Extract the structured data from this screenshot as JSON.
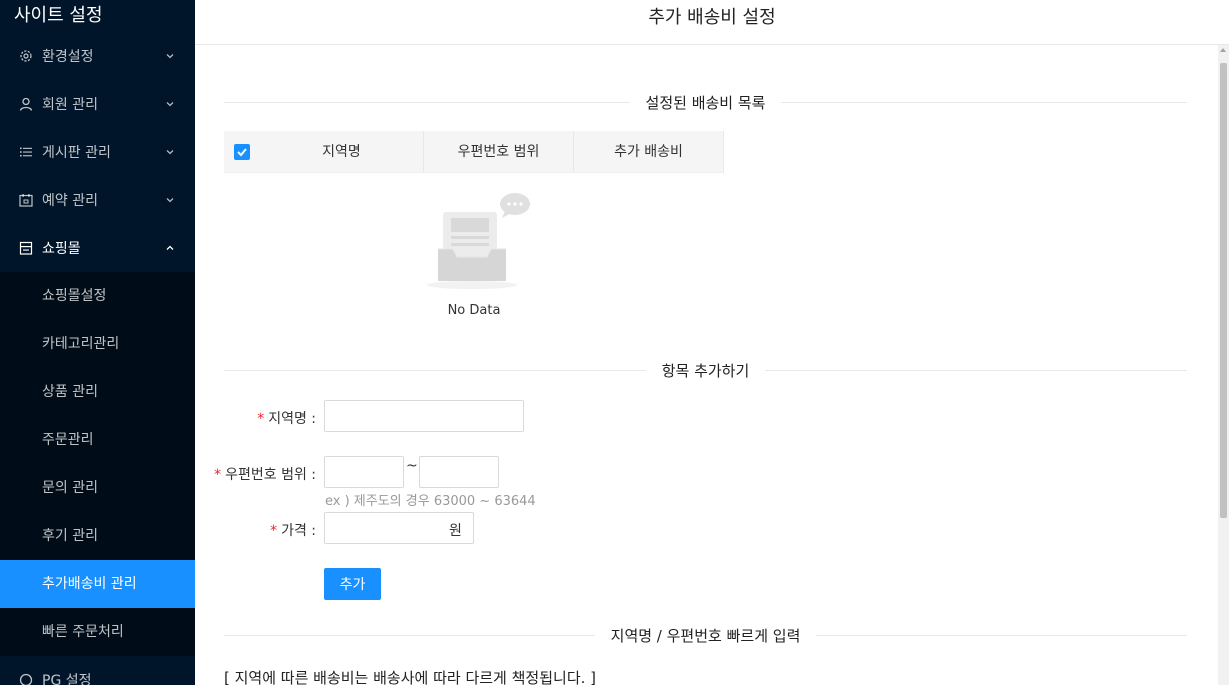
{
  "sidebar": {
    "title": "사이트 설정",
    "menu": [
      {
        "label": "환경설정"
      },
      {
        "label": "회원 관리"
      },
      {
        "label": "게시판 관리"
      },
      {
        "label": "예약 관리"
      },
      {
        "label": "쇼핑몰"
      }
    ],
    "submenu": [
      {
        "label": "쇼핑몰설정"
      },
      {
        "label": "카테고리관리"
      },
      {
        "label": "상품 관리"
      },
      {
        "label": "주문관리"
      },
      {
        "label": "문의 관리"
      },
      {
        "label": "후기 관리"
      },
      {
        "label": "추가배송비 관리"
      },
      {
        "label": "빠른 주문처리"
      }
    ],
    "bottom_item": "PG 설정"
  },
  "header": {
    "title": "추가 배송비 설정"
  },
  "list_section": {
    "divider": "설정된 배송비 목록",
    "columns": [
      "지역명",
      "우편번호 범위",
      "추가 배송비"
    ],
    "select_all_checked": true,
    "empty_text": "No Data"
  },
  "add_section": {
    "divider": "항목 추가하기",
    "region_label": "지역명 :",
    "postal_label": "우편번호 범위 :",
    "range_separator": "~",
    "postal_hint": "ex ) 제주도의 경우 63000 ~ 63644",
    "price_label": "가격 :",
    "price_suffix": "원",
    "submit_label": "추가"
  },
  "quick_section": {
    "divider": "지역명 / 우편번호 빠르게 입력",
    "note": "[ 지역에 따른 배송비는 배송사에 따라 다르게 책정됩니다. ]"
  },
  "colors": {
    "sidebar_bg": "#001529",
    "submenu_bg": "#000c17",
    "accent": "#1890ff",
    "required": "#f5222d"
  }
}
